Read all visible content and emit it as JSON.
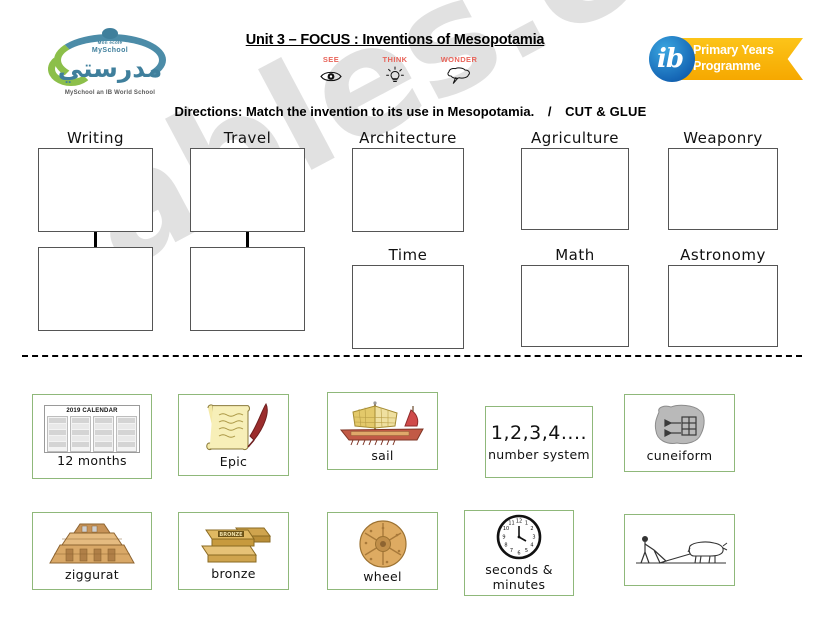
{
  "header": {
    "title": "Unit 3 – FOCUS : Inventions of Mesopotamia",
    "school_logo": {
      "french_name": "Mon école",
      "english_name": "MySchool",
      "arabic_name": "مدرستي",
      "tagline": "MySchool an IB World School"
    },
    "ib_logo": {
      "mark": "ib",
      "line1": "Primary Years",
      "line2": "Programme"
    },
    "thinking_routine": [
      {
        "label": "SEE",
        "icon": "eye-icon"
      },
      {
        "label": "THINK",
        "icon": "lightbulb-icon"
      },
      {
        "label": "WONDER",
        "icon": "thought-bubble-icon"
      }
    ],
    "accent_red": "#e8645a",
    "accent_blue": "#1566b5",
    "accent_gold": "#f6a800"
  },
  "directions": {
    "text": "Directions: Match the invention to its use in Mesopotamia.",
    "separator": "/",
    "cut_glue": "CUT & GLUE"
  },
  "categories": [
    {
      "label": "Writing",
      "connected": true
    },
    {
      "label": "Travel",
      "connected": true
    },
    {
      "label": "Architecture",
      "connected": false
    },
    {
      "label": "Agriculture",
      "connected": false
    },
    {
      "label": "Weaponry",
      "connected": false
    },
    {
      "label": "Time",
      "connected": false
    },
    {
      "label": "Math",
      "connected": false
    },
    {
      "label": "Astronomy",
      "connected": false
    }
  ],
  "cut_line": "dashed-cut-line",
  "cards": [
    {
      "label": "12 months",
      "icon": "calendar-icon",
      "calendar_title": "2019 CALENDAR"
    },
    {
      "label": "Epic",
      "icon": "scroll-quill-icon"
    },
    {
      "label": "sail",
      "icon": "sailing-ship-icon"
    },
    {
      "label": "number system",
      "icon": "numerals-text",
      "numerals": "1,2,3,4...."
    },
    {
      "label": "cuneiform",
      "icon": "clay-tablet-icon"
    },
    {
      "label": "ziggurat",
      "icon": "ziggurat-icon"
    },
    {
      "label": "bronze",
      "icon": "bronze-bars-icon",
      "bar_text": "BRONZE"
    },
    {
      "label": "wheel",
      "icon": "wheel-icon"
    },
    {
      "label": "seconds & minutes",
      "icon": "clock-icon"
    },
    {
      "label": "",
      "icon": "plow-oxen-icon"
    }
  ],
  "watermark": "ables.com",
  "colors": {
    "card_border": "#8fb87a",
    "box_border": "#555555"
  }
}
